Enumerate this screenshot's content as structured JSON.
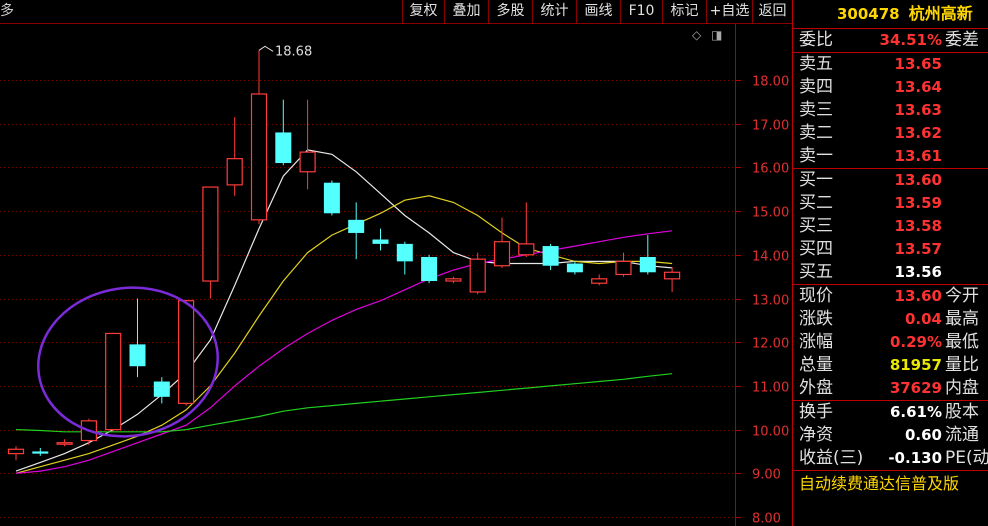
{
  "toolbar": {
    "left_text": "多",
    "buttons": [
      "复权",
      "叠加",
      "多股",
      "统计",
      "画线",
      "F10",
      "标记",
      "+自选",
      "返回"
    ]
  },
  "icons": {
    "diamond": "◇",
    "toggle": "◨"
  },
  "stock": {
    "code": "300478",
    "name": "杭州高新"
  },
  "weibi": {
    "label": "委比",
    "value": "34.51%",
    "label2": "委差"
  },
  "sells": [
    {
      "label": "卖五",
      "price": "13.65"
    },
    {
      "label": "卖四",
      "price": "13.64"
    },
    {
      "label": "卖三",
      "price": "13.63"
    },
    {
      "label": "卖二",
      "price": "13.62"
    },
    {
      "label": "卖一",
      "price": "13.61"
    }
  ],
  "buys": [
    {
      "label": "买一",
      "price": "13.60"
    },
    {
      "label": "买二",
      "price": "13.59"
    },
    {
      "label": "买三",
      "price": "13.58"
    },
    {
      "label": "买四",
      "price": "13.57"
    },
    {
      "label": "买五",
      "price": "13.56"
    }
  ],
  "quote": [
    {
      "label": "现价",
      "value": "13.60",
      "label2": "今开",
      "color": "red"
    },
    {
      "label": "涨跌",
      "value": "0.04",
      "label2": "最高",
      "color": "red"
    },
    {
      "label": "涨幅",
      "value": "0.29%",
      "label2": "最低",
      "color": "red"
    },
    {
      "label": "总量",
      "value": "81957",
      "label2": "量比",
      "color": "yellow"
    },
    {
      "label": "外盘",
      "value": "37629",
      "label2": "内盘",
      "color": "red"
    }
  ],
  "extra": [
    {
      "label": "换手",
      "value": "6.61%",
      "label2": "股本"
    },
    {
      "label": "净资",
      "value": "0.60",
      "label2": "流通"
    },
    {
      "label": "收益(三)",
      "value": "-0.130",
      "label2": "PE(动"
    }
  ],
  "news": "自动续费通达信普及版",
  "chart_data": {
    "type": "candlestick",
    "y_ticks": [
      "18.00",
      "17.00",
      "16.00",
      "15.00",
      "14.00",
      "13.00",
      "12.00",
      "11.00",
      "10.00",
      "9.00",
      "8.00"
    ],
    "ylim": [
      8.0,
      18.0
    ],
    "peak_label": "18.68",
    "peak_value": 18.68,
    "candles": [
      {
        "o": 9.45,
        "c": 9.55,
        "h": 9.62,
        "l": 9.3
      },
      {
        "o": 9.5,
        "c": 9.45,
        "h": 9.58,
        "l": 9.4
      },
      {
        "o": 9.7,
        "c": 9.7,
        "h": 9.78,
        "l": 9.62
      },
      {
        "o": 9.75,
        "c": 10.2,
        "h": 10.25,
        "l": 9.65
      },
      {
        "o": 10.0,
        "c": 12.2,
        "h": 12.22,
        "l": 9.95
      },
      {
        "o": 11.95,
        "c": 11.45,
        "h": 13.0,
        "l": 11.2
      },
      {
        "o": 11.1,
        "c": 10.75,
        "h": 11.2,
        "l": 10.6
      },
      {
        "o": 10.6,
        "c": 12.95,
        "h": 12.97,
        "l": 10.55
      },
      {
        "o": 13.4,
        "c": 15.55,
        "h": 15.55,
        "l": 13.0
      },
      {
        "o": 15.6,
        "c": 16.2,
        "h": 17.15,
        "l": 15.35
      },
      {
        "o": 14.8,
        "c": 17.68,
        "h": 18.68,
        "l": 14.7
      },
      {
        "o": 16.8,
        "c": 16.1,
        "h": 17.55,
        "l": 16.05
      },
      {
        "o": 15.9,
        "c": 16.35,
        "h": 17.55,
        "l": 15.5
      },
      {
        "o": 15.65,
        "c": 14.95,
        "h": 15.7,
        "l": 14.9
      },
      {
        "o": 14.8,
        "c": 14.5,
        "h": 15.2,
        "l": 13.9
      },
      {
        "o": 14.35,
        "c": 14.25,
        "h": 14.6,
        "l": 14.1
      },
      {
        "o": 14.25,
        "c": 13.85,
        "h": 14.3,
        "l": 13.55
      },
      {
        "o": 13.95,
        "c": 13.4,
        "h": 14.0,
        "l": 13.35
      },
      {
        "o": 13.4,
        "c": 13.45,
        "h": 13.5,
        "l": 13.35
      },
      {
        "o": 13.15,
        "c": 13.9,
        "h": 14.05,
        "l": 13.1
      },
      {
        "o": 13.75,
        "c": 14.3,
        "h": 14.85,
        "l": 13.7
      },
      {
        "o": 14.0,
        "c": 14.25,
        "h": 15.2,
        "l": 13.95
      },
      {
        "o": 14.2,
        "c": 13.75,
        "h": 14.25,
        "l": 13.65
      },
      {
        "o": 13.8,
        "c": 13.6,
        "h": 13.85,
        "l": 13.55
      },
      {
        "o": 13.35,
        "c": 13.45,
        "h": 13.55,
        "l": 13.3
      },
      {
        "o": 13.55,
        "c": 13.85,
        "h": 14.05,
        "l": 13.5
      },
      {
        "o": 13.95,
        "c": 13.6,
        "h": 14.45,
        "l": 13.55
      },
      {
        "o": 13.45,
        "c": 13.6,
        "h": 13.72,
        "l": 13.15
      }
    ],
    "ma_lines": [
      {
        "color": "#e8e8e8",
        "values": [
          9.05,
          9.25,
          9.45,
          9.7,
          10.0,
          10.35,
          10.8,
          11.3,
          12.05,
          13.3,
          14.6,
          15.8,
          16.4,
          16.3,
          15.9,
          15.4,
          14.9,
          14.5,
          14.05,
          13.85,
          13.8,
          13.8,
          13.8,
          13.85,
          13.85,
          13.85,
          13.75,
          13.7
        ]
      },
      {
        "color": "#e0d020",
        "values": [
          9.0,
          9.15,
          9.3,
          9.45,
          9.65,
          9.85,
          10.1,
          10.45,
          11.0,
          11.75,
          12.6,
          13.4,
          14.05,
          14.45,
          14.7,
          14.95,
          15.25,
          15.35,
          15.2,
          14.9,
          14.5,
          14.15,
          14.0,
          13.85,
          13.8,
          13.85,
          13.85,
          13.8
        ]
      },
      {
        "color": "#e000e0",
        "values": [
          9.0,
          9.05,
          9.15,
          9.3,
          9.5,
          9.7,
          9.9,
          10.1,
          10.5,
          11.0,
          11.45,
          11.85,
          12.2,
          12.5,
          12.75,
          12.95,
          13.2,
          13.45,
          13.65,
          13.8,
          13.9,
          14.0,
          14.1,
          14.2,
          14.3,
          14.4,
          14.48,
          14.55
        ]
      },
      {
        "color": "#20d020",
        "values": [
          10.0,
          9.98,
          9.95,
          9.95,
          9.95,
          9.95,
          9.95,
          10.0,
          10.1,
          10.2,
          10.3,
          10.42,
          10.5,
          10.55,
          10.6,
          10.65,
          10.7,
          10.75,
          10.8,
          10.85,
          10.9,
          10.95,
          11.0,
          11.05,
          11.1,
          11.15,
          11.22,
          11.28
        ]
      }
    ]
  }
}
